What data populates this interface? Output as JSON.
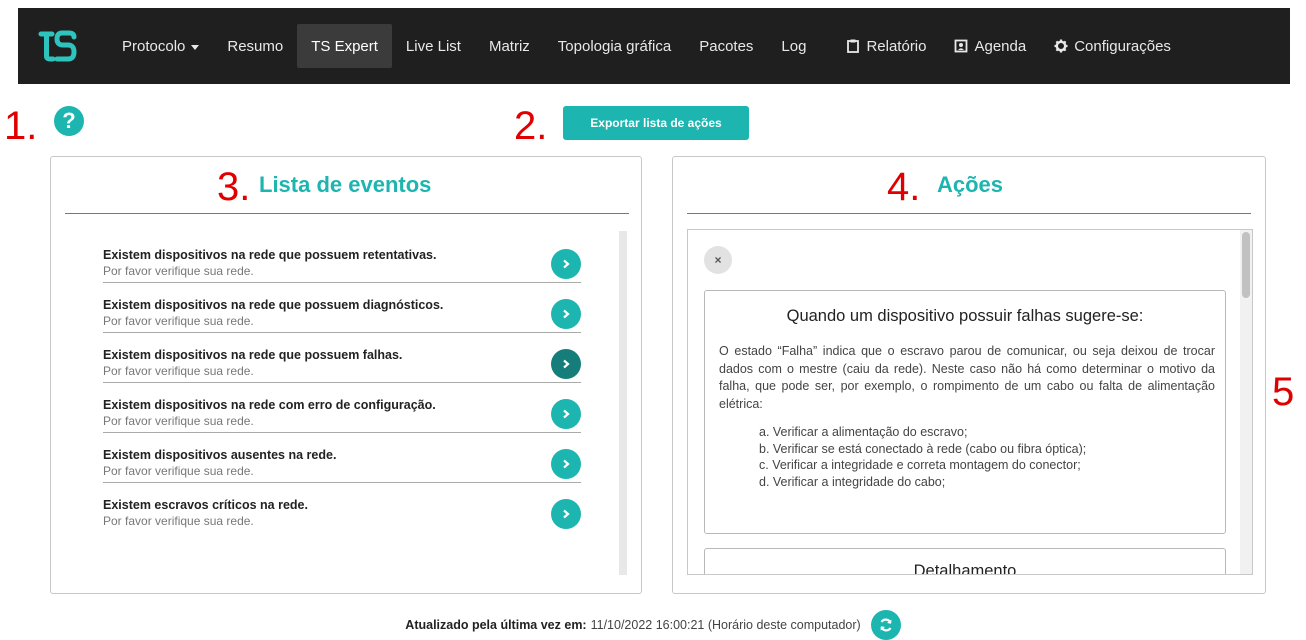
{
  "navbar": {
    "logo_icon": "ts-logo",
    "items": [
      {
        "label": "Protocolo",
        "dropdown": true
      },
      {
        "label": "Resumo"
      },
      {
        "label": "TS Expert",
        "active": true
      },
      {
        "label": "Live List"
      },
      {
        "label": "Matriz"
      },
      {
        "label": "Topologia gráfica"
      },
      {
        "label": "Pacotes"
      },
      {
        "label": "Log"
      }
    ],
    "right_items": [
      {
        "label": "Relatório",
        "icon": "clipboard-icon"
      },
      {
        "label": "Agenda",
        "icon": "contact-book-icon"
      },
      {
        "label": "Configurações",
        "icon": "gear-icon"
      }
    ]
  },
  "markers": [
    "1.",
    "2.",
    "3.",
    "4.",
    "5"
  ],
  "help_icon_glyph": "?",
  "export_label": "Exportar lista de ações",
  "events_panel": {
    "title": "Lista de eventos",
    "items": [
      {
        "title": "Existem dispositivos na rede que possuem retentativas.",
        "subtitle": "Por favor verifique sua rede."
      },
      {
        "title": "Existem dispositivos na rede que possuem diagnósticos.",
        "subtitle": "Por favor verifique sua rede."
      },
      {
        "title": "Existem dispositivos na rede que possuem falhas.",
        "subtitle": "Por favor verifique sua rede.",
        "selected": true
      },
      {
        "title": "Existem dispositivos na rede com erro de configuração.",
        "subtitle": "Por favor verifique sua rede."
      },
      {
        "title": "Existem dispositivos ausentes na rede.",
        "subtitle": "Por favor verifique sua rede."
      },
      {
        "title": "Existem escravos críticos na rede.",
        "subtitle": "Por favor verifique sua rede."
      }
    ]
  },
  "actions_panel": {
    "title": "Ações",
    "close_glyph": "×",
    "card_title": "Quando um dispositivo possuir falhas sugere-se:",
    "card_body": "O estado “Falha” indica que o escravo parou de comunicar, ou seja deixou de trocar dados com o mestre (caiu da rede). Neste caso não há como determinar o motivo da falha, que pode ser, por exemplo, o rompimento de um cabo ou falta de alimentação elétrica:",
    "steps": [
      "a. Verificar a alimentação do escravo;",
      "b. Verificar se está conectado à rede (cabo ou fibra óptica);",
      "c. Verificar a integridade e correta montagem do conector;",
      "d. Verificar a integridade do cabo;"
    ],
    "detail_title": "Detalhamento"
  },
  "footer": {
    "label": "Atualizado pela última vez em:",
    "value": "11/10/2022 16:00:21 (Horário deste computador)"
  },
  "colors": {
    "accent": "#1cb5b0",
    "accent_dark": "#157d7a",
    "navbar_bg": "#1f1f1f",
    "marker": "#e00000"
  }
}
